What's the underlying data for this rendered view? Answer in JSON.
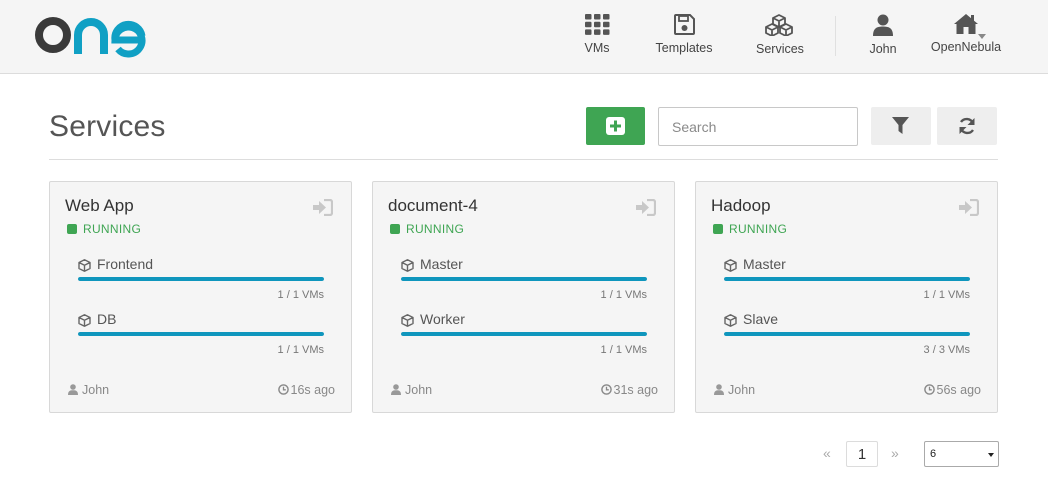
{
  "app": {
    "logo_text": "one",
    "colors": {
      "accent": "#0f96bd",
      "success": "#3fa553",
      "logo_dark": "#3a3a3a",
      "logo_blue": "#10a0c4"
    }
  },
  "nav": {
    "vms": {
      "label": "VMs",
      "icon": "grid-icon"
    },
    "templates": {
      "label": "Templates",
      "icon": "floppy-icon"
    },
    "services": {
      "label": "Services",
      "icon": "cubes-icon"
    },
    "user": {
      "label": "John",
      "icon": "user-icon"
    },
    "zone": {
      "label": "OpenNebula",
      "icon": "home-icon"
    }
  },
  "page": {
    "title": "Services",
    "add_icon": "plus-square-icon",
    "search_placeholder": "Search",
    "filter_icon": "filter-icon",
    "refresh_icon": "refresh-icon"
  },
  "services": [
    {
      "name": "Web App",
      "status": "RUNNING",
      "roles": [
        {
          "name": "Frontend",
          "count": "1 / 1 VMs",
          "progress": 1.0
        },
        {
          "name": "DB",
          "count": "1 / 1 VMs",
          "progress": 1.0
        }
      ],
      "owner": "John",
      "time": "16s ago"
    },
    {
      "name": "document-4",
      "status": "RUNNING",
      "roles": [
        {
          "name": "Master",
          "count": "1 / 1 VMs",
          "progress": 1.0
        },
        {
          "name": "Worker",
          "count": "1 / 1 VMs",
          "progress": 1.0
        }
      ],
      "owner": "John",
      "time": "31s ago"
    },
    {
      "name": "Hadoop",
      "status": "RUNNING",
      "roles": [
        {
          "name": "Master",
          "count": "1 / 1 VMs",
          "progress": 1.0
        },
        {
          "name": "Slave",
          "count": "3 / 3 VMs",
          "progress": 1.0
        }
      ],
      "owner": "John",
      "time": "56s ago"
    }
  ],
  "pagination": {
    "prev": "«",
    "current": "1",
    "next": "»",
    "page_size": "6"
  }
}
